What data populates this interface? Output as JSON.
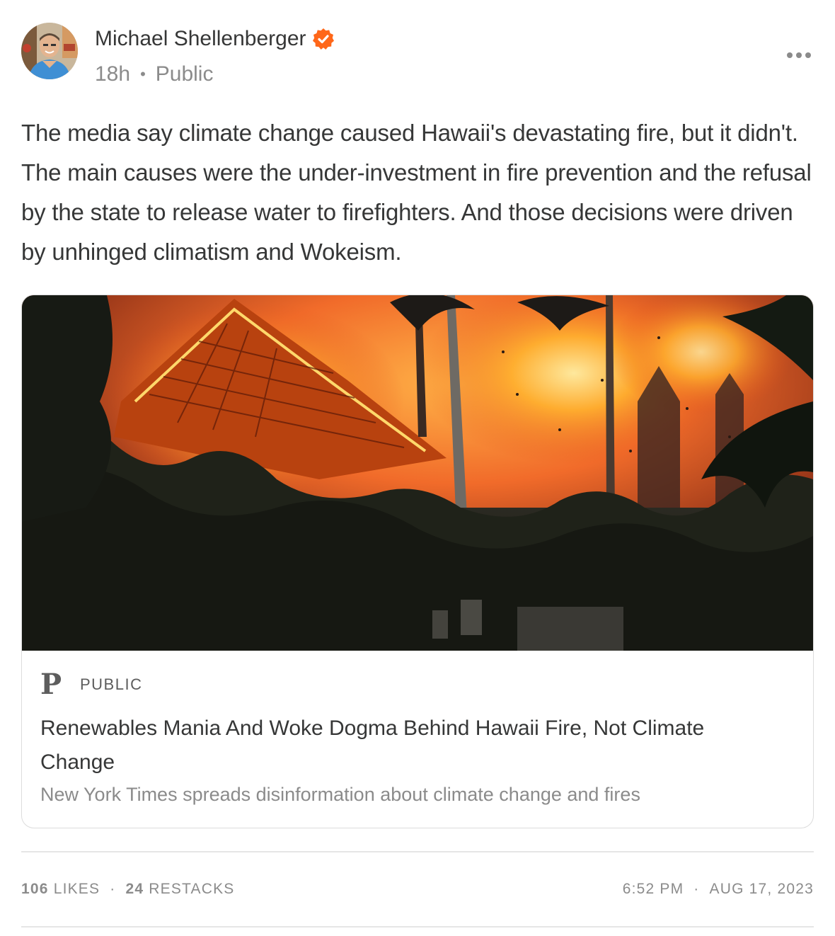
{
  "post": {
    "author": {
      "name": "Michael Shellenberger",
      "verified": true,
      "avatar_icon": "profile-photo"
    },
    "time_ago": "18h",
    "visibility": "Public",
    "more_icon": "more-horizontal-icon",
    "text": "The media say climate change caused Hawaii's devastating fire, but it didn't. The main causes were the under-investment in fire prevention and the refusal by the state to release water to firefighters. And those decisions were driven by unhinged climatism and Wokeism.",
    "embed": {
      "image_description_icon": "burning-building-photo",
      "source_logo": "P",
      "source_name": "PUBLIC",
      "title": "Renewables Mania And Woke Dogma Behind Hawaii Fire, Not Climate Change",
      "subtitle": "New York Times spreads disinformation about climate change and fires"
    },
    "stats": {
      "likes_count": "106",
      "likes_label": "LIKES",
      "restacks_count": "24",
      "restacks_label": "RESTACKS",
      "time": "6:52 PM",
      "date": "AUG 17, 2023"
    }
  },
  "colors": {
    "text": "#363737",
    "muted": "#8b8b8b",
    "verified": "#ff6719",
    "border": "#dcdcdc"
  }
}
